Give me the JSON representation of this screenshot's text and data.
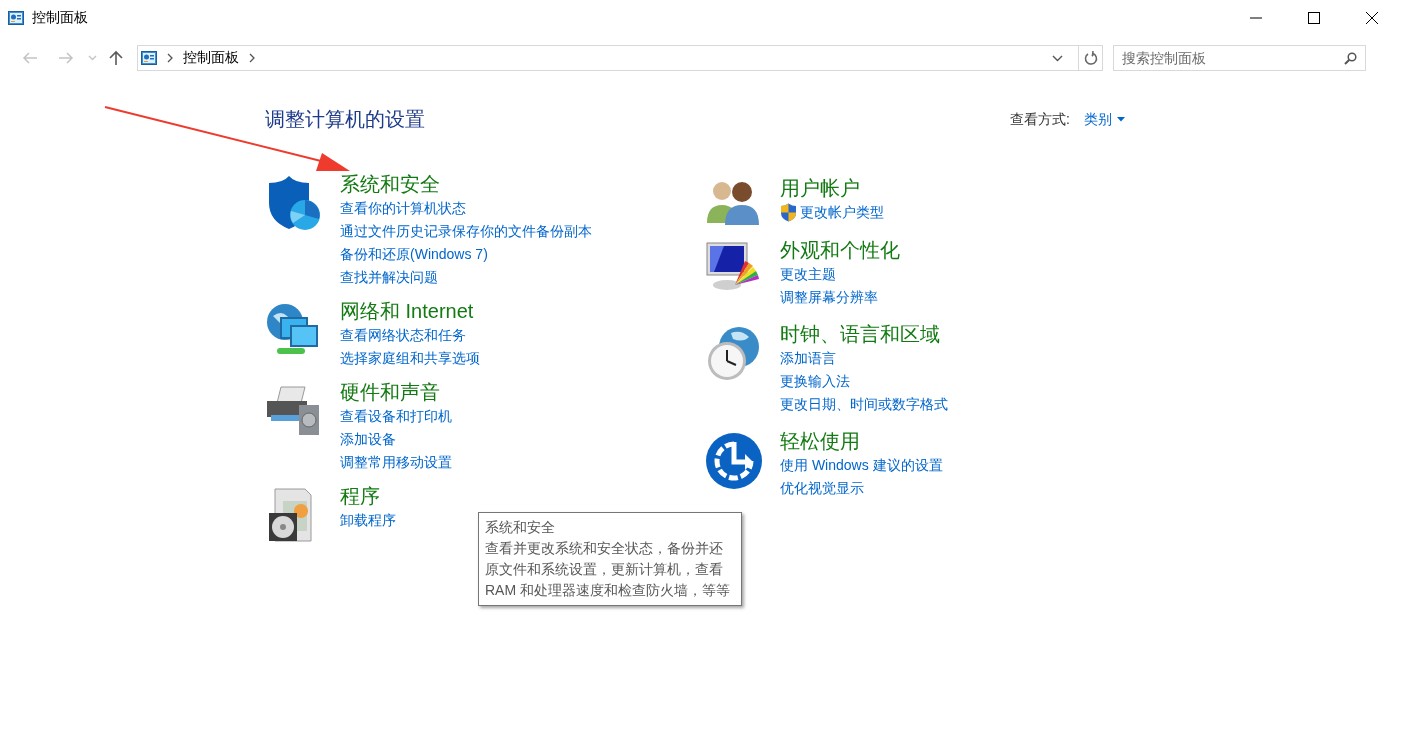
{
  "window": {
    "title": "控制面板"
  },
  "nav": {
    "back": {
      "disabled": true
    },
    "forward": {
      "disabled": true
    },
    "up": {
      "disabled": false
    }
  },
  "address": {
    "path": [
      "控制面板"
    ]
  },
  "search": {
    "placeholder": "搜索控制面板"
  },
  "heading": "调整计算机的设置",
  "view_by": {
    "label": "查看方式:",
    "value": "类别"
  },
  "columns": [
    {
      "categories": [
        {
          "title": "系统和安全",
          "links": [
            {
              "label": "查看你的计算机状态",
              "kind": "plain"
            },
            {
              "label": "通过文件历史记录保存你的文件备份副本",
              "kind": "plain"
            },
            {
              "label": "备份和还原(Windows 7)",
              "kind": "plain"
            },
            {
              "label": "查找并解决问题",
              "kind": "plain"
            }
          ]
        },
        {
          "title": "网络和 Internet",
          "links": [
            {
              "label": "查看网络状态和任务",
              "kind": "plain"
            },
            {
              "label": "选择家庭组和共享选项",
              "kind": "plain"
            }
          ]
        },
        {
          "title": "硬件和声音",
          "links": [
            {
              "label": "查看设备和打印机",
              "kind": "plain"
            },
            {
              "label": "添加设备",
              "kind": "plain"
            },
            {
              "label": "调整常用移动设置",
              "kind": "plain"
            }
          ]
        },
        {
          "title": "程序",
          "links": [
            {
              "label": "卸载程序",
              "kind": "plain"
            }
          ]
        }
      ]
    },
    {
      "categories": [
        {
          "title": "用户帐户",
          "links": [
            {
              "label": "更改帐户类型",
              "kind": "shield"
            }
          ]
        },
        {
          "title": "外观和个性化",
          "links": [
            {
              "label": "更改主题",
              "kind": "plain"
            },
            {
              "label": "调整屏幕分辨率",
              "kind": "plain"
            }
          ]
        },
        {
          "title": "时钟、语言和区域",
          "links": [
            {
              "label": "添加语言",
              "kind": "plain"
            },
            {
              "label": "更换输入法",
              "kind": "plain"
            },
            {
              "label": "更改日期、时间或数字格式",
              "kind": "plain"
            }
          ]
        },
        {
          "title": "轻松使用",
          "links": [
            {
              "label": "使用 Windows 建议的设置",
              "kind": "plain"
            },
            {
              "label": "优化视觉显示",
              "kind": "plain"
            }
          ]
        }
      ]
    }
  ],
  "tooltip": {
    "title": "系统和安全",
    "text": "查看并更改系统和安全状态，备份并还原文件和系统设置，更新计算机，查看 RAM 和处理器速度和检查防火墙，等等"
  }
}
